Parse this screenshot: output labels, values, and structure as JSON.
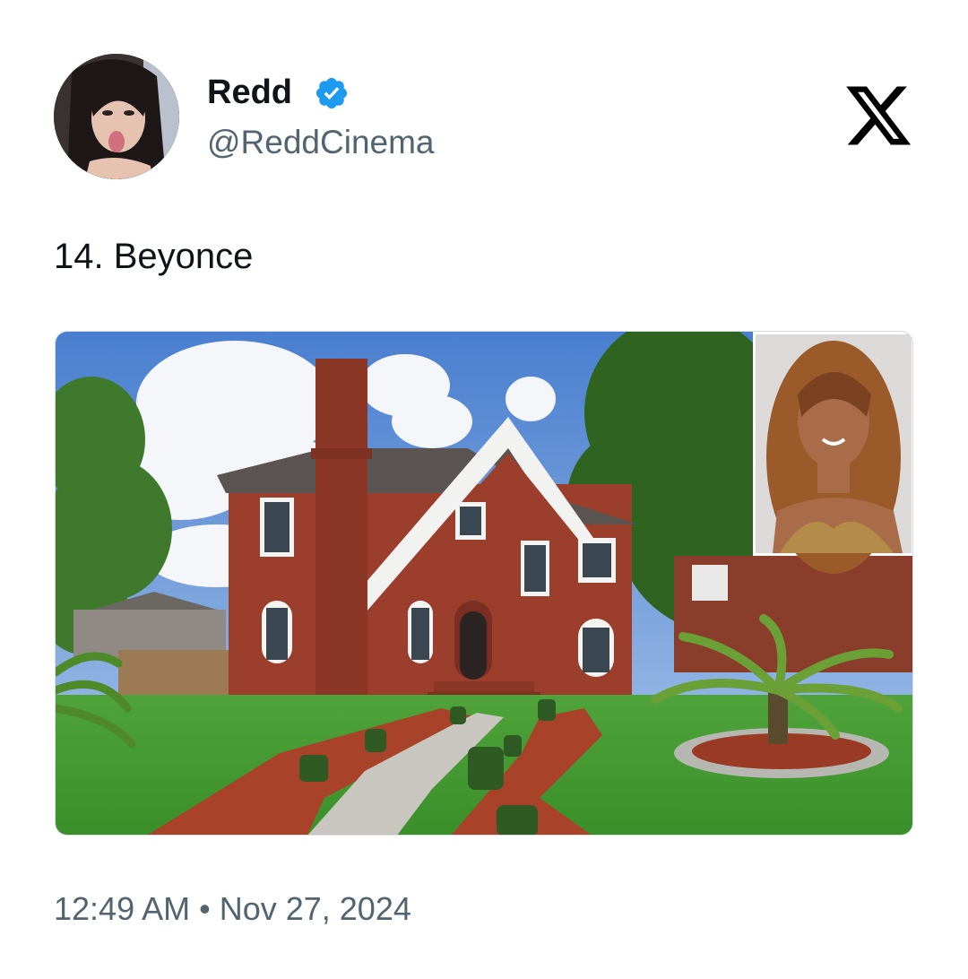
{
  "author": {
    "display_name": "Redd",
    "handle": "@ReddCinema",
    "verified": true
  },
  "icons": {
    "verified": "verified-badge-icon",
    "platform": "x-logo-icon"
  },
  "tweet": {
    "text": "14. Beyonce",
    "timestamp": "12:49 AM • Nov 27, 2024"
  },
  "colors": {
    "verified_blue": "#1d9bf0",
    "secondary_text": "#536471",
    "primary_text": "#0f1419"
  }
}
